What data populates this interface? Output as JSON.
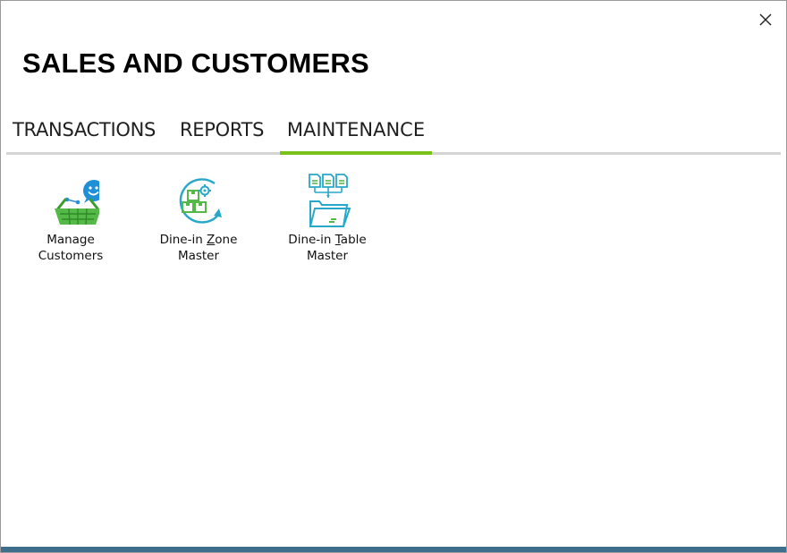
{
  "window": {
    "title": "SALES AND CUSTOMERS",
    "close_icon": "close-icon"
  },
  "tabs": [
    {
      "label": "TRANSACTIONS",
      "active": false
    },
    {
      "label": "REPORTS",
      "active": false
    },
    {
      "label": "MAINTENANCE",
      "active": true
    }
  ],
  "accent_color": "#7cc21e",
  "tiles": [
    {
      "label_line1": "Manage",
      "label_line2": "Customers",
      "icon": "customer-basket-icon"
    },
    {
      "label_line1_pre": "Dine-in ",
      "label_line1_mnemonic": "Z",
      "label_line1_post": "one",
      "label_line2": "Master",
      "icon": "zone-master-icon"
    },
    {
      "label_line1_pre": "Dine-in ",
      "label_line1_mnemonic": "T",
      "label_line1_post": "able",
      "label_line2": "Master",
      "icon": "table-master-icon"
    }
  ]
}
